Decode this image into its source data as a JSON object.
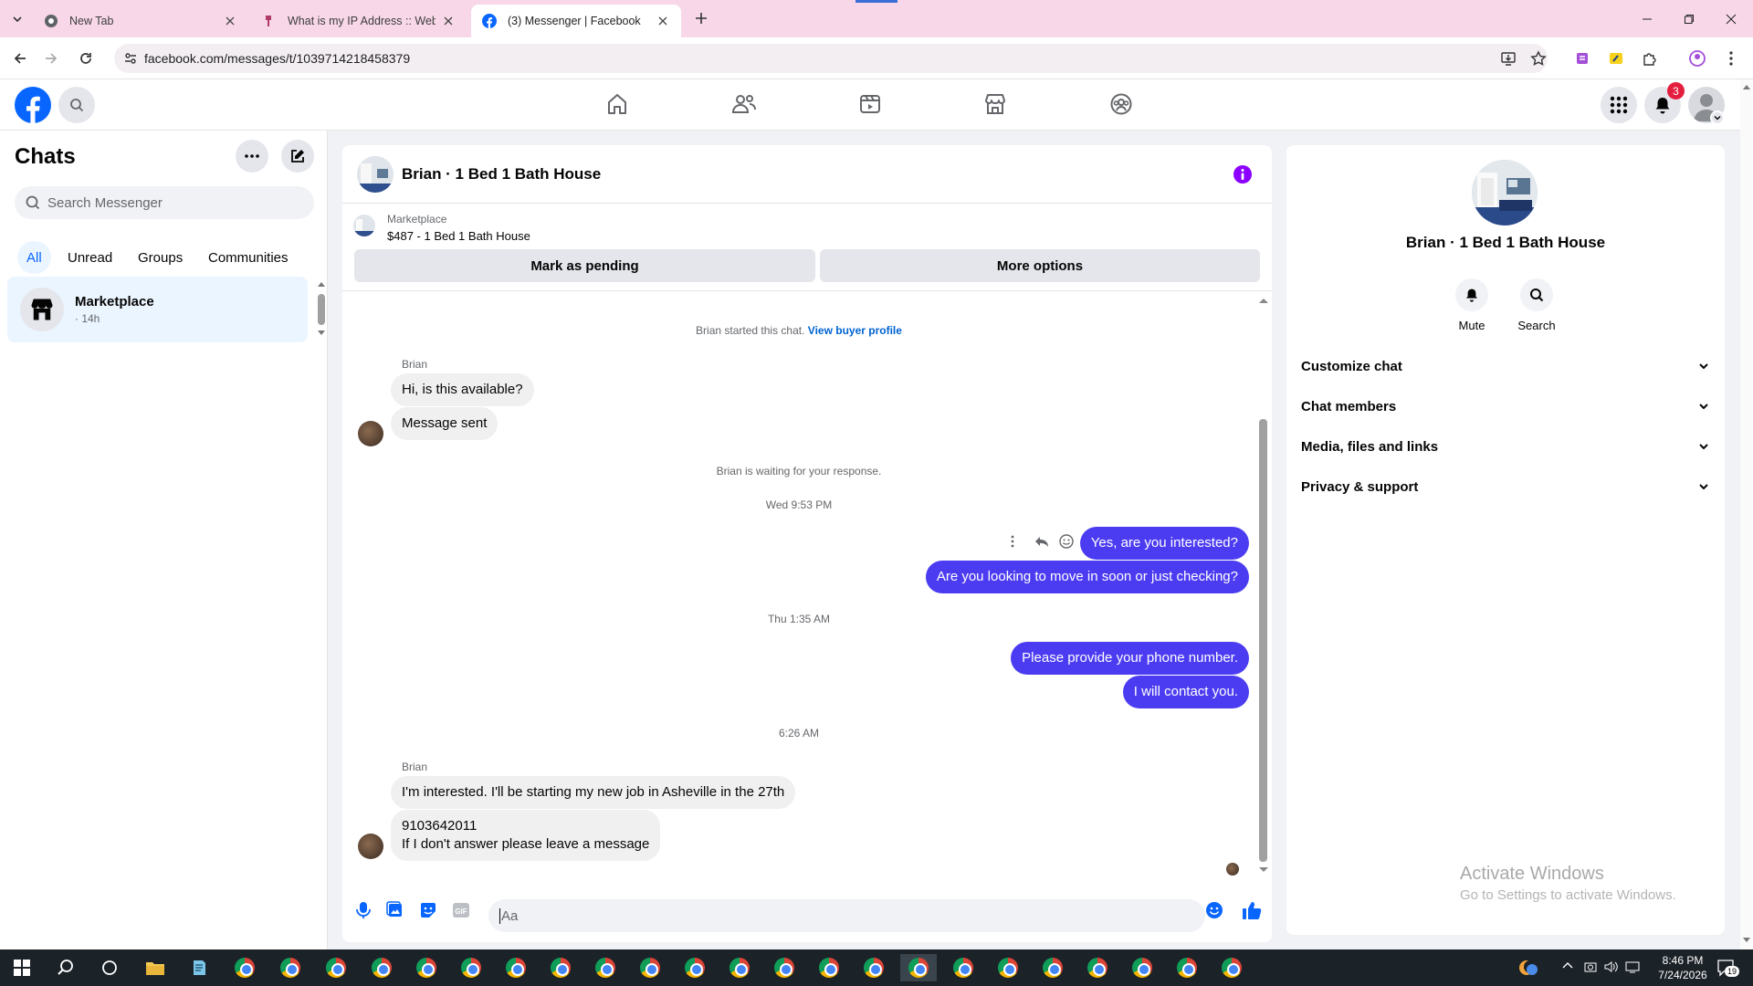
{
  "browser": {
    "tabs": [
      {
        "title": "New Tab",
        "icon": "chrome-icon"
      },
      {
        "title": "What is my IP Address :: WebBr",
        "icon": "webbrowsertools-icon"
      },
      {
        "title": "(3) Messenger | Facebook",
        "icon": "facebook-icon",
        "active": true
      }
    ],
    "url": "facebook.com/messages/t/1039714218458379"
  },
  "fb_header": {
    "notifications_count": "3"
  },
  "sidebar": {
    "title": "Chats",
    "search_placeholder": "Search Messenger",
    "filters": [
      "All",
      "Unread",
      "Groups",
      "Communities"
    ],
    "chats": [
      {
        "name": "Marketplace",
        "time": "· 14h"
      }
    ]
  },
  "conversation": {
    "title": "Brian · 1 Bed 1 Bath House",
    "marketplace_label": "Marketplace",
    "listing": "$487 - 1 Bed 1 Bath House",
    "mark_pending": "Mark as pending",
    "more_options": "More options",
    "started_text": "Brian started this chat.",
    "view_buyer": "View buyer profile",
    "sender_name": "Brian",
    "msg1": "Hi, is this available?",
    "msg2": "Message sent",
    "waiting": "Brian is waiting for your response.",
    "ts1": "Wed 9:53 PM",
    "out1": "Yes, are you interested?",
    "out2": "Are you looking to move in soon or just checking?",
    "ts2": "Thu 1:35 AM",
    "out3": "Please provide your phone number.",
    "out4": "I will contact you.",
    "ts3": "6:26 AM",
    "msg3": "I'm interested. I'll be starting my new job in Asheville in the 27th",
    "msg4_line1": "9103642011",
    "msg4_line2": "If  I don't answer please leave a message",
    "composer_placeholder": "Aa"
  },
  "details": {
    "name": "Brian · 1 Bed 1 Bath House",
    "mute": "Mute",
    "search": "Search",
    "sections": [
      "Customize chat",
      "Chat members",
      "Media, files and links",
      "Privacy & support"
    ]
  },
  "watermark": {
    "line1": "Activate Windows",
    "line2": "Go to Settings to activate Windows."
  },
  "taskbar": {
    "time": "8:46 PM",
    "date": "7/24/2026",
    "notif": "19"
  },
  "colors": {
    "accent": "#0866ff",
    "outgoing_bubble": "#4c3cf1",
    "tab_strip": "#f8d8e8"
  }
}
